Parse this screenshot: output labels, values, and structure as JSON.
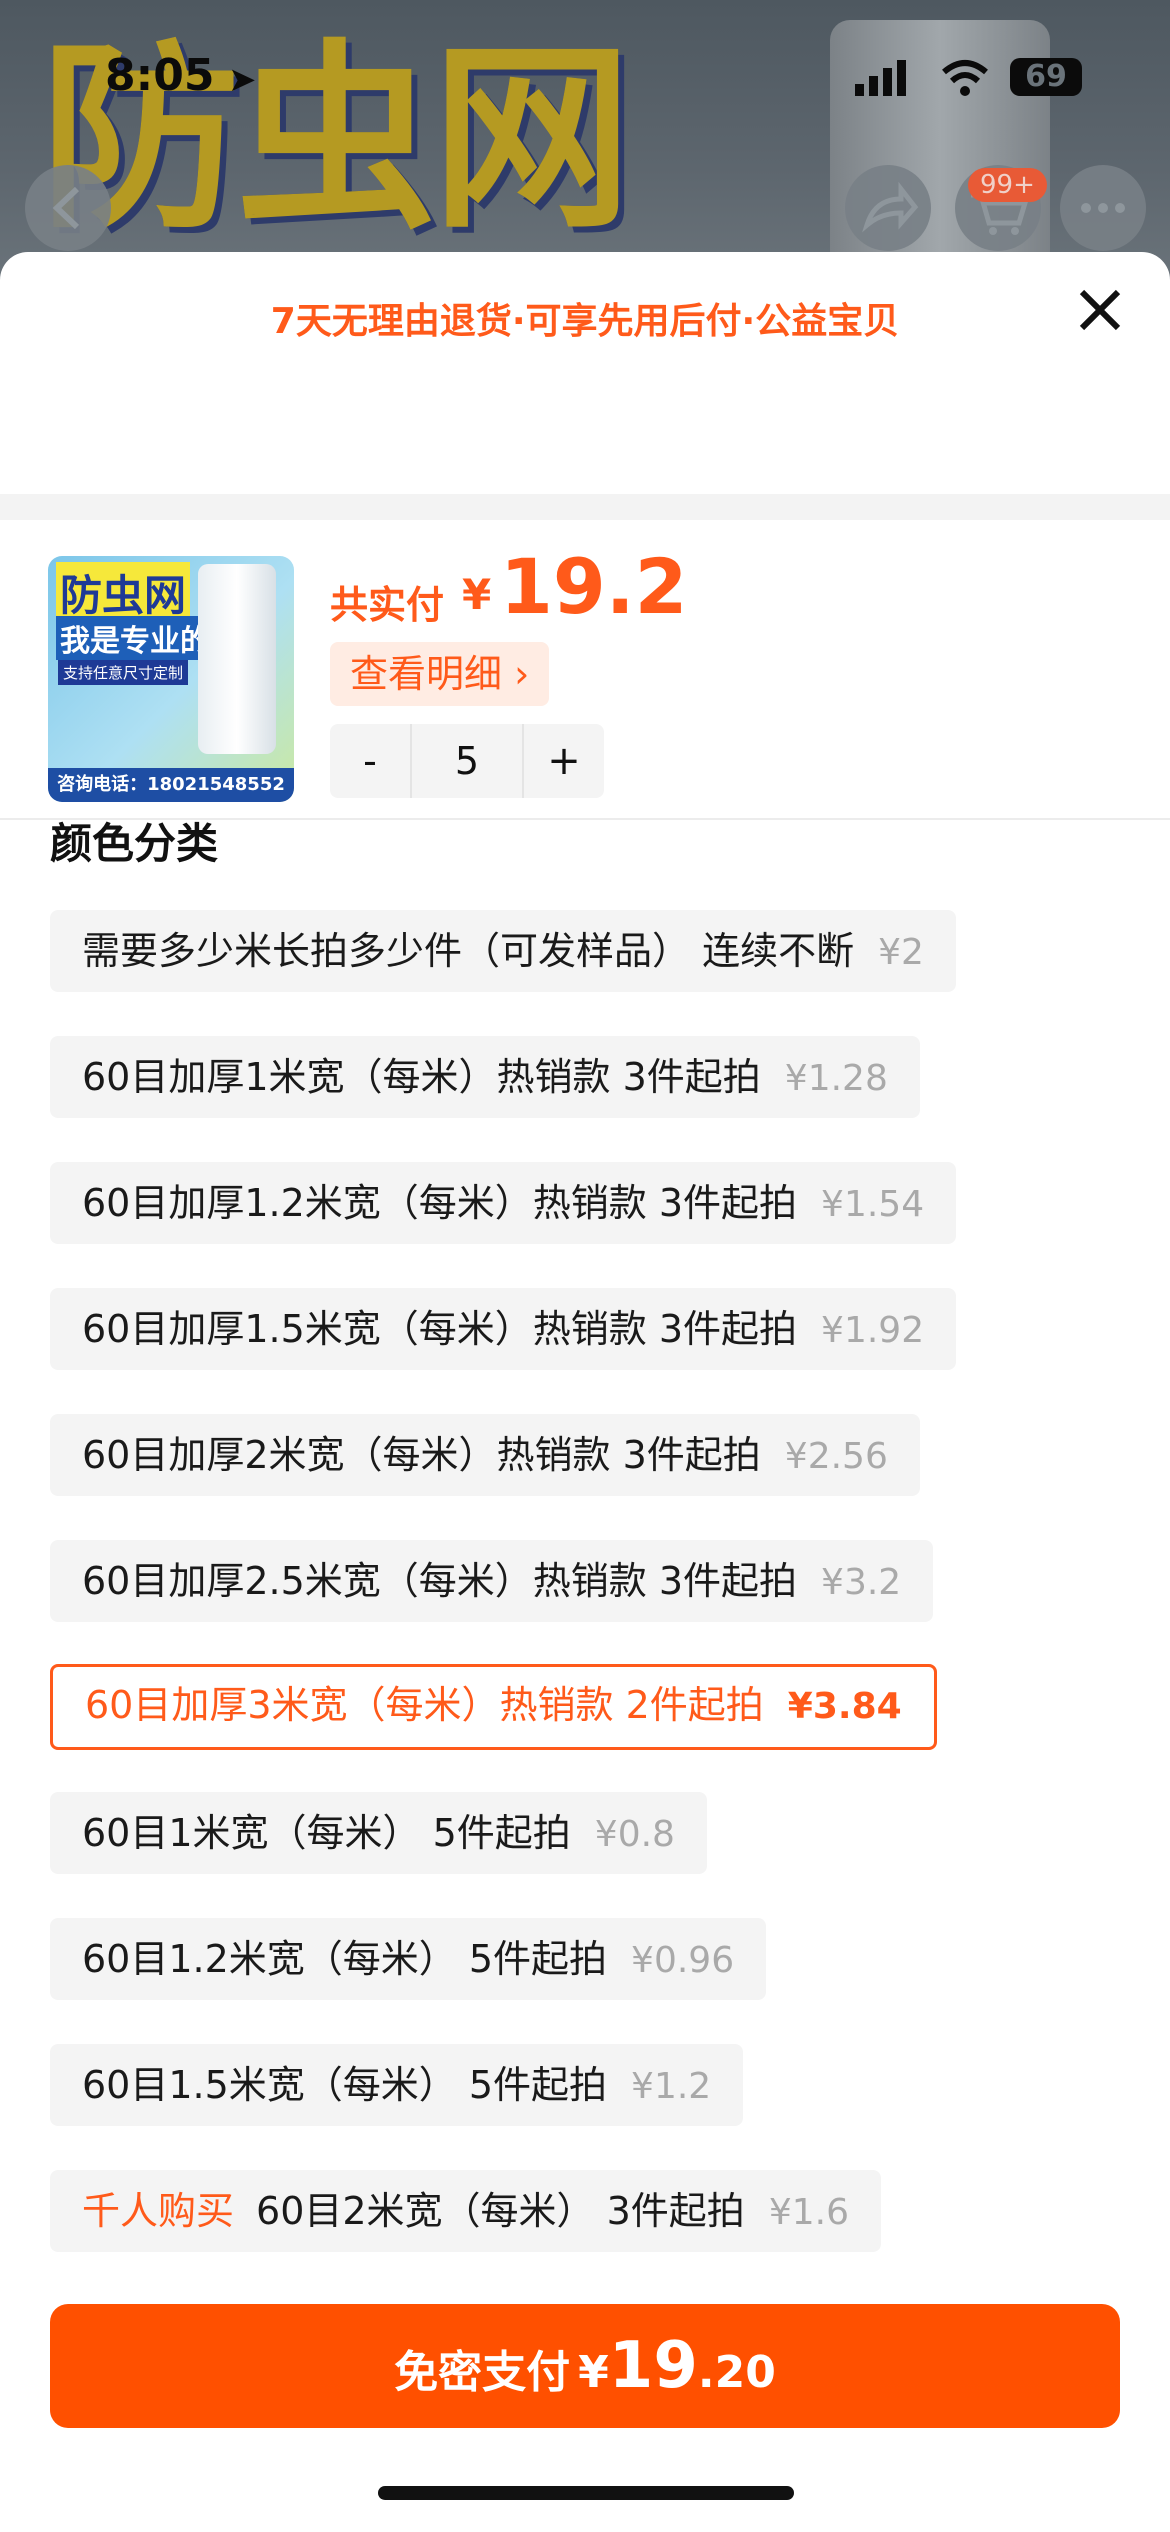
{
  "status_bar": {
    "time": "8:05",
    "battery": "69"
  },
  "background": {
    "title": "防虫网",
    "cart_badge": "99+"
  },
  "sheet": {
    "promo": "7天无理由退货·可享先用后付·公益宝贝",
    "close_icon": "close-icon"
  },
  "product": {
    "thumb_title": "防虫网",
    "thumb_sub": "我是专业的",
    "thumb_tag": "支持任意尺寸定制",
    "thumb_phone": "咨询电话：18021548552",
    "total_label": "共实付",
    "currency": "¥",
    "total_amount": "19.2",
    "detail_label": "查看明细 ›",
    "qty_minus": "-",
    "qty_value": "5",
    "qty_plus": "+"
  },
  "section_title": "颜色分类",
  "options": [
    {
      "label": "需要多少米长拍多少件（可发样品） 连续不断",
      "price": "¥2"
    },
    {
      "label": "60目加厚1米宽（每米）热销款 3件起拍",
      "price": "¥1.28"
    },
    {
      "label": "60目加厚1.2米宽（每米）热销款 3件起拍",
      "price": "¥1.54"
    },
    {
      "label": "60目加厚1.5米宽（每米）热销款 3件起拍",
      "price": "¥1.92"
    },
    {
      "label": "60目加厚2米宽（每米）热销款 3件起拍",
      "price": "¥2.56"
    },
    {
      "label": "60目加厚2.5米宽（每米）热销款 3件起拍",
      "price": "¥3.2"
    },
    {
      "label": "60目加厚3米宽（每米）热销款 2件起拍",
      "price": "¥3.84",
      "selected": true
    },
    {
      "label": "60目1米宽（每米） 5件起拍",
      "price": "¥0.8"
    },
    {
      "label": "60目1.2米宽（每米） 5件起拍",
      "price": "¥0.96"
    },
    {
      "label": "60目1.5米宽（每米） 5件起拍",
      "price": "¥1.2"
    },
    {
      "hot": "千人购买",
      "label": "60目2米宽（每米） 3件起拍",
      "price": "¥1.6"
    }
  ],
  "pay": {
    "label": "免密支付",
    "currency": "¥",
    "amount_int": "19",
    "amount_dec": ".20"
  },
  "colors": {
    "accent": "#ff5000",
    "accent_text": "#ff5a1a"
  }
}
